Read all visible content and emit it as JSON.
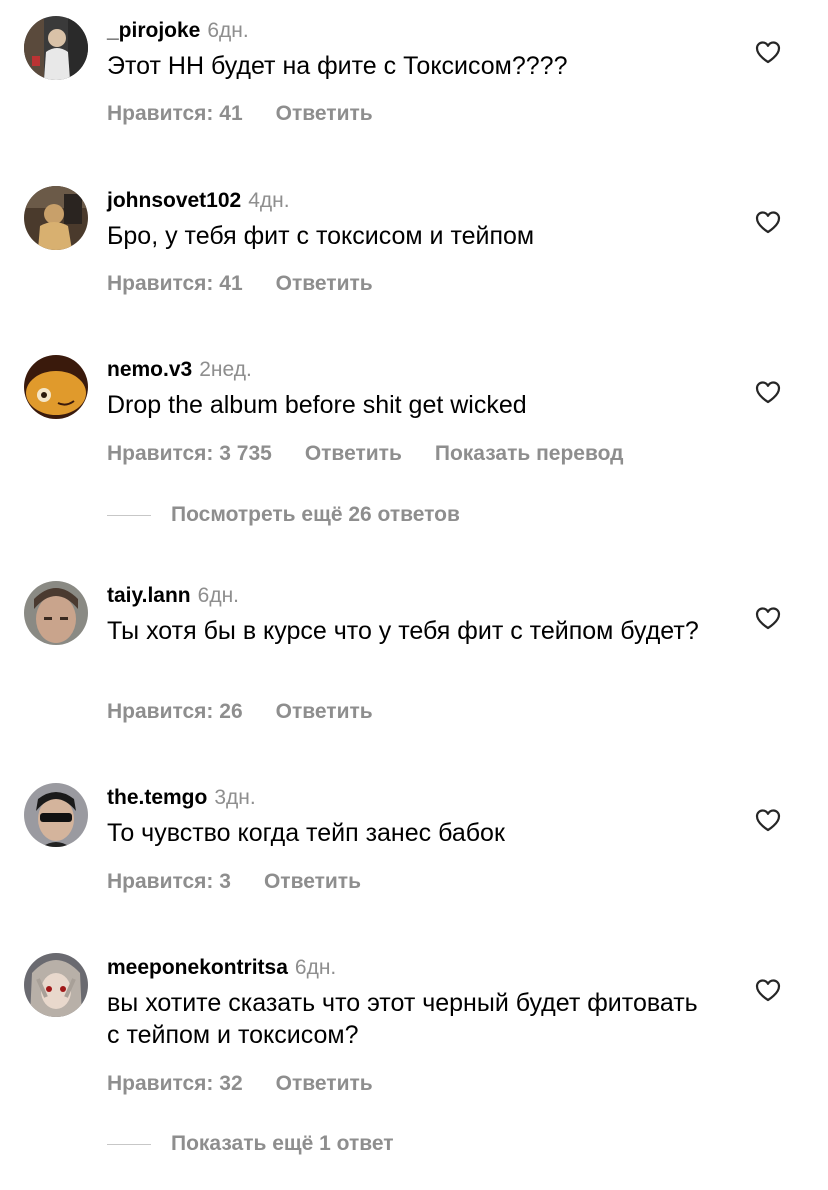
{
  "comments": [
    {
      "username": "_pirojoke",
      "time": "6дн.",
      "text": "Этот НН будет на фите с Токсисом????",
      "likes_label": "Нравится: 41",
      "reply_label": "Ответить"
    },
    {
      "username": "johnsovet102",
      "time": "4дн.",
      "text": "Бро, у тебя фит с токсисом и тейпом",
      "likes_label": "Нравится: 41",
      "reply_label": "Ответить"
    },
    {
      "username": "nemo.v3",
      "time": "2нед.",
      "text": "Drop the album before shit get wicked",
      "likes_label": "Нравится: 3 735",
      "reply_label": "Ответить",
      "translate_label": "Показать перевод",
      "view_replies_label": "Посмотреть ещё 26 ответов"
    },
    {
      "username": "taiy.lann",
      "time": "6дн.",
      "text": "Ты хотя бы в курсе что у тебя фит с тейпом будет?",
      "likes_label": "Нравится: 26",
      "reply_label": "Ответить"
    },
    {
      "username": "the.temgo",
      "time": "3дн.",
      "text": "То чувство когда тейп занес бабок",
      "likes_label": "Нравится: 3",
      "reply_label": "Ответить"
    },
    {
      "username": "meeponekontritsa",
      "time": "6дн.",
      "text": "вы хотите сказать что этот черный будет фитовать с тейпом и токсисом?",
      "likes_label": "Нравится: 32",
      "reply_label": "Ответить",
      "view_replies_label": "Показать ещё 1 ответ"
    }
  ],
  "colors": {
    "text": "#000000",
    "secondary": "#8e8e8e",
    "divider": "#c7c7c7"
  }
}
